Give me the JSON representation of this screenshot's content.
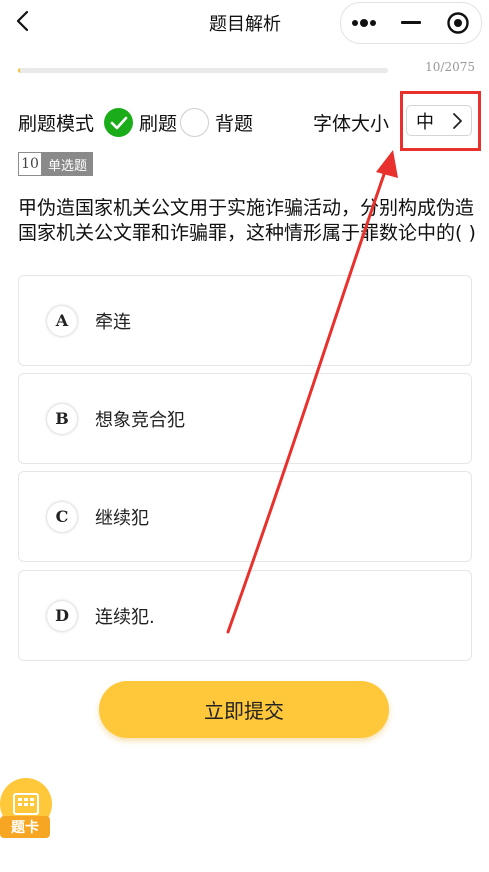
{
  "header": {
    "title": "题目解析"
  },
  "progress": {
    "label": "10/2075",
    "current": 10,
    "total": 2075
  },
  "mode": {
    "label": "刷题模式",
    "options": [
      {
        "label": "刷题",
        "selected": true
      },
      {
        "label": "背题",
        "selected": false
      }
    ]
  },
  "font_size": {
    "label": "字体大小",
    "value": "中"
  },
  "question": {
    "number": "10",
    "type": "单选题",
    "text": "甲伪造国家机关公文用于实施诈骗活动，分别构成伪造国家机关公文罪和诈骗罪，这种情形属于罪数论中的( )"
  },
  "options": [
    {
      "letter": "A",
      "text": "牵连"
    },
    {
      "letter": "B",
      "text": "想象竞合犯"
    },
    {
      "letter": "C",
      "text": "继续犯"
    },
    {
      "letter": "D",
      "text": "连续犯."
    }
  ],
  "submit_label": "立即提交",
  "answer_card_label": "题卡",
  "colors": {
    "accent": "#ffc83a",
    "selected_green": "#1aad19",
    "annotation_red": "#e8312c"
  }
}
